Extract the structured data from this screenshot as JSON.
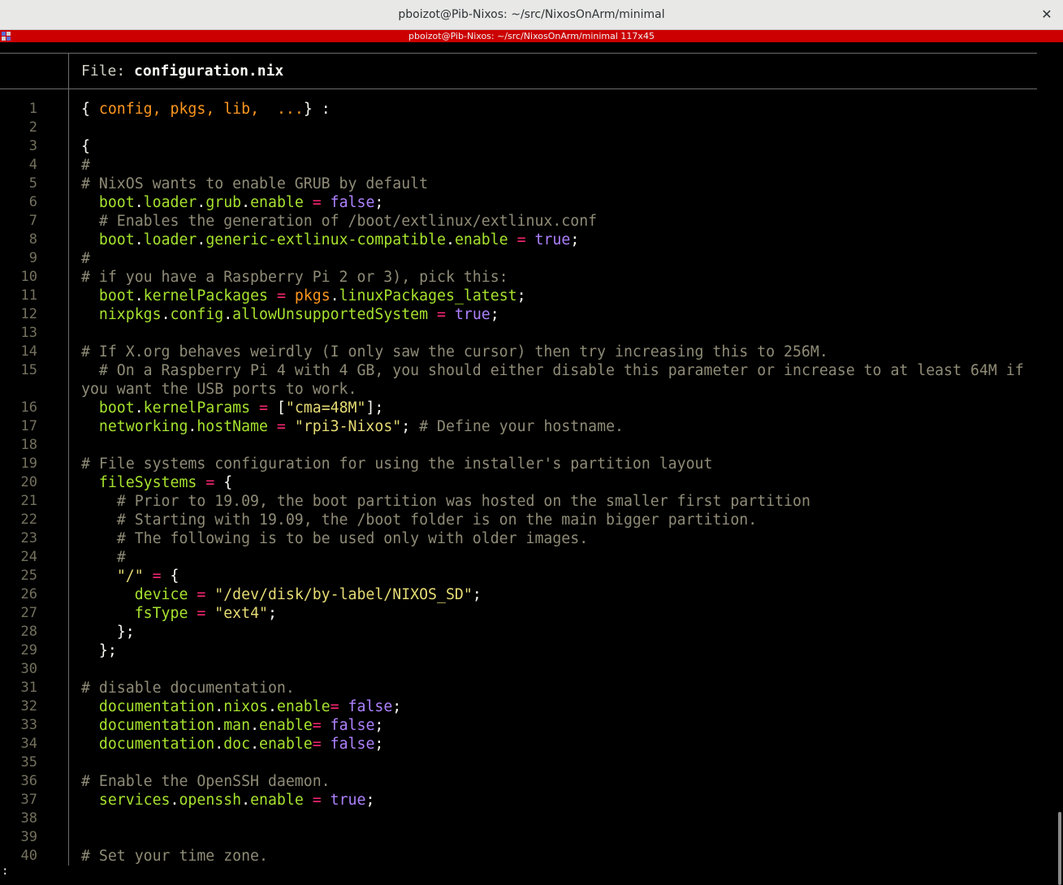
{
  "window": {
    "title": "pboizot@Pib-Nixos: ~/src/NixosOnArm/minimal",
    "close_glyph": "✕",
    "tab_title": "pboizot@Pib-Nixos: ~/src/NixosOnArm/minimal 117x45"
  },
  "editor": {
    "file_label": "File: ",
    "file_name": "configuration.nix",
    "prompt": ":",
    "line_numbers": [
      "1",
      "2",
      "3",
      "4",
      "5",
      "6",
      "7",
      "8",
      "9",
      "10",
      "11",
      "12",
      "13",
      "14",
      "15",
      "16",
      "17",
      "18",
      "19",
      "20",
      "21",
      "22",
      "23",
      "24",
      "25",
      "26",
      "27",
      "28",
      "29",
      "30",
      "31",
      "32",
      "33",
      "34",
      "35",
      "36",
      "37",
      "38",
      "39",
      "40"
    ],
    "lines": [
      "{ config, pkgs, lib,  ...} :",
      "",
      "{",
      "#",
      "# NixOS wants to enable GRUB by default",
      "  boot.loader.grub.enable = false;",
      "  # Enables the generation of /boot/extlinux/extlinux.conf",
      "  boot.loader.generic-extlinux-compatible.enable = true;",
      "#",
      "# if you have a Raspberry Pi 2 or 3), pick this:",
      "  boot.kernelPackages = pkgs.linuxPackages_latest;",
      "  nixpkgs.config.allowUnsupportedSystem = true;",
      "",
      "# If X.org behaves weirdly (I only saw the cursor) then try increasing this to 256M.",
      "  # On a Raspberry Pi 4 with 4 GB, you should either disable this parameter or increase to at least 64M if you want the USB ports to work.",
      "  boot.kernelParams = [\"cma=48M\"];",
      "  networking.hostName = \"rpi3-Nixos\"; # Define your hostname.",
      "",
      "# File systems configuration for using the installer's partition layout",
      "  fileSystems = {",
      "    # Prior to 19.09, the boot partition was hosted on the smaller first partition",
      "    # Starting with 19.09, the /boot folder is on the main bigger partition.",
      "    # The following is to be used only with older images.",
      "    #",
      "    \"/\" = {",
      "      device = \"/dev/disk/by-label/NIXOS_SD\";",
      "      fsType = \"ext4\";",
      "    };",
      "  };",
      "",
      "# disable documentation.",
      "  documentation.nixos.enable= false;",
      "  documentation.man.enable= false;",
      "  documentation.doc.enable= false;",
      "",
      "# Enable the OpenSSH daemon.",
      "  services.openssh.enable = true;",
      "",
      "",
      "# Set your time zone."
    ]
  },
  "syntax_colors": {
    "background": "#000000",
    "text": "#f8f8f2",
    "comment": "#8f8b76",
    "attribute": "#a6e22e",
    "operator": "#f92672",
    "string": "#e6db74",
    "boolean": "#ae81ff",
    "parameter": "#fd971f",
    "line_number": "#75715e",
    "tab_bar": "#cc0000"
  }
}
